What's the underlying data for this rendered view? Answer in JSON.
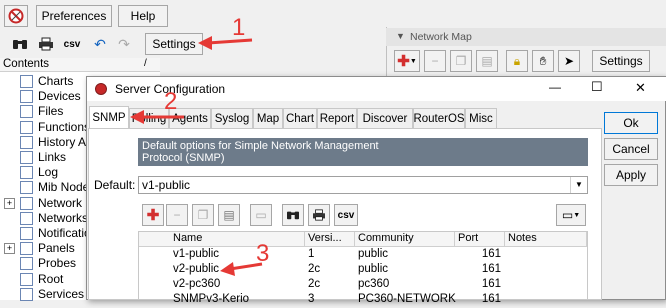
{
  "main_toolbar": {
    "preferences_label": "Preferences",
    "help_label": "Help",
    "settings_label": "Settings",
    "csv_label": "csv"
  },
  "contents": {
    "header": "Contents",
    "sort_indicator": "/",
    "items": [
      {
        "label": "Charts",
        "expandable": false
      },
      {
        "label": "Devices",
        "expandable": false
      },
      {
        "label": "Files",
        "expandable": false
      },
      {
        "label": "Functions",
        "expandable": false
      },
      {
        "label": "History Ac",
        "expandable": false
      },
      {
        "label": "Links",
        "expandable": false
      },
      {
        "label": "Log",
        "expandable": false
      },
      {
        "label": "Mib Nodes",
        "expandable": false
      },
      {
        "label": "Network M",
        "expandable": true
      },
      {
        "label": "Networks",
        "expandable": false
      },
      {
        "label": "Notificatio",
        "expandable": false
      },
      {
        "label": "Panels",
        "expandable": true
      },
      {
        "label": "Probes",
        "expandable": false
      },
      {
        "label": "Root",
        "expandable": false
      },
      {
        "label": "Services",
        "expandable": false
      }
    ]
  },
  "network_map": {
    "title": "Network Map",
    "settings_label": "Settings"
  },
  "dialog": {
    "title": "Server Configuration",
    "minimize": "—",
    "maximize": "☐",
    "close": "✕",
    "tabs": [
      "SNMP",
      "Polling",
      "Agents",
      "Syslog",
      "Map",
      "Chart",
      "Report",
      "Discover",
      "RouterOS",
      "Misc"
    ],
    "active_tab": "SNMP",
    "description": "Default options for Simple Network Management Protocol (SNMP)",
    "default_label": "Default:",
    "default_value": "v1-public",
    "csv_label": "csv",
    "ok_label": "Ok",
    "cancel_label": "Cancel",
    "apply_label": "Apply",
    "table": {
      "columns": [
        "Name",
        "Versi...",
        "Community",
        "Port",
        "Notes"
      ],
      "rows": [
        {
          "name": "v1-public",
          "version": "1",
          "community": "public",
          "port": "161",
          "notes": ""
        },
        {
          "name": "v2-public",
          "version": "2c",
          "community": "public",
          "port": "161",
          "notes": ""
        },
        {
          "name": "v2-pc360",
          "version": "2c",
          "community": "pc360",
          "port": "161",
          "notes": ""
        },
        {
          "name": "SNMPv3-Kerio",
          "version": "3",
          "community": "PC360-NETWORK",
          "port": "161",
          "notes": ""
        }
      ]
    }
  },
  "annotations": {
    "step1": "1",
    "step2": "2",
    "step3": "3",
    "color": "#e53935"
  }
}
